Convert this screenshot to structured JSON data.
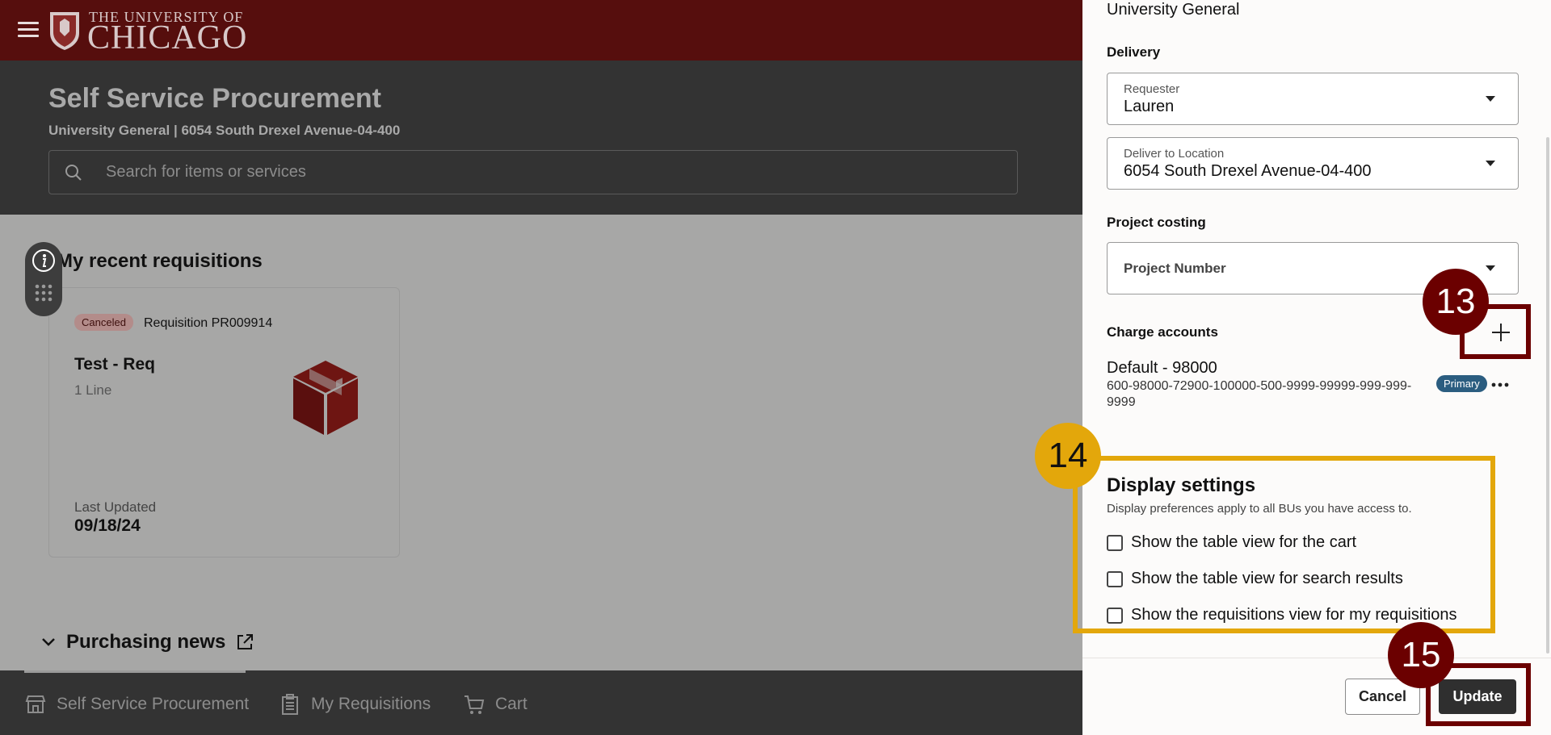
{
  "brand": {
    "top_line": "THE UNIVERSITY OF",
    "main_line": "CHICAGO"
  },
  "header": {
    "title": "Self Service Procurement",
    "subtitle": "University General | 6054 South Drexel Avenue-04-400",
    "search_placeholder": "Search for items or services"
  },
  "recent": {
    "title": "My recent requisitions",
    "card": {
      "status": "Canceled",
      "requisition": "Requisition PR009914",
      "name": "Test - Req",
      "lines": "1 Line",
      "updated_label": "Last Updated",
      "updated_date": "09/18/24"
    }
  },
  "news": {
    "title": "Purchasing news"
  },
  "bottom_nav": {
    "items": [
      {
        "label": "Self Service Procurement"
      },
      {
        "label": "My Requisitions"
      },
      {
        "label": "Cart"
      }
    ]
  },
  "drawer": {
    "business_unit": "University General",
    "delivery_label": "Delivery",
    "requester": {
      "label": "Requester",
      "value": "Lauren"
    },
    "deliver_to": {
      "label": "Deliver to Location",
      "value": "6054 South Drexel Avenue-04-400"
    },
    "project_costing_label": "Project costing",
    "project_number_placeholder": "Project Number",
    "charge_accounts_label": "Charge accounts",
    "account": {
      "name": "Default - 98000",
      "code": "600-98000-72900-100000-500-9999-99999-999-999-9999",
      "badge": "Primary"
    },
    "display_settings": {
      "title": "Display settings",
      "description": "Display preferences apply to all BUs you have access to.",
      "options": [
        {
          "label": "Show the table view for the cart",
          "checked": false
        },
        {
          "label": "Show the table view for search results",
          "checked": false
        },
        {
          "label": "Show the requisitions view for my requisitions",
          "checked": false
        }
      ]
    },
    "cancel_label": "Cancel",
    "update_label": "Update"
  },
  "annotations": {
    "step_13": "13",
    "step_14": "14",
    "step_15": "15"
  },
  "colors": {
    "brand_maroon": "#560e0d",
    "annotation_red": "#6b0000",
    "annotation_yellow": "#e3a70b",
    "primary_badge": "#2b5d80"
  }
}
